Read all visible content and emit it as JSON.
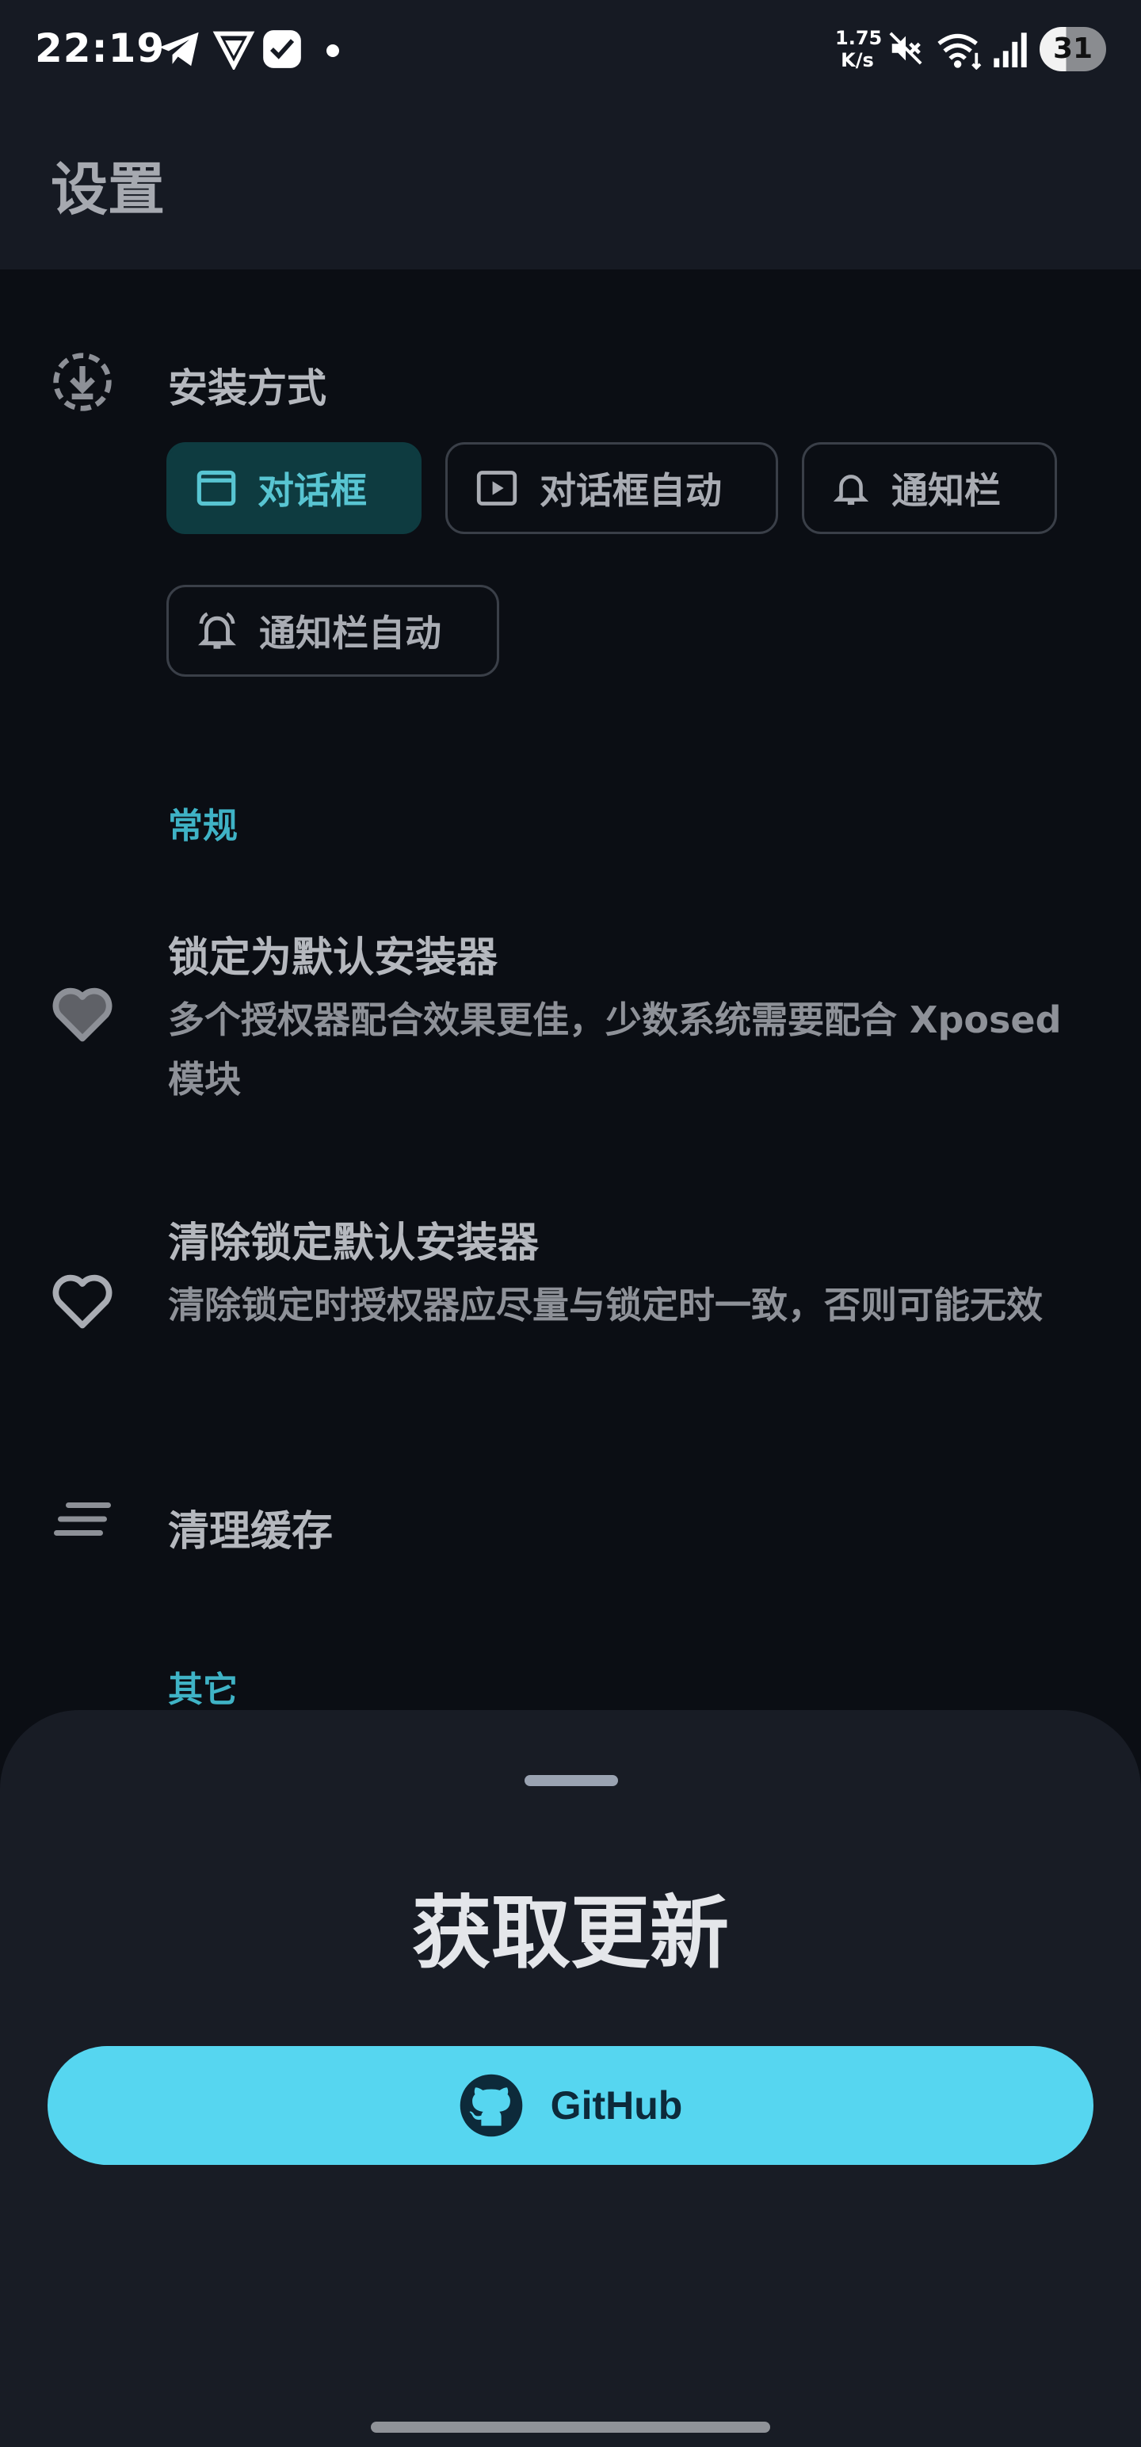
{
  "status_bar": {
    "time": "22:19",
    "net_speed_value": "1.75",
    "net_speed_unit": "K/s",
    "battery": "31",
    "icons": [
      "telegram-icon",
      "vpn-icon",
      "notification-app-icon",
      "dot-icon",
      "mute-icon",
      "wifi-icon",
      "signal-icon",
      "battery-icon"
    ]
  },
  "app_bar": {
    "title": "设置"
  },
  "install_method": {
    "title": "安装方式",
    "icon": "download-icon",
    "options": [
      {
        "label": "对话框",
        "icon": "window-icon",
        "selected": true
      },
      {
        "label": "对话框自动",
        "icon": "play-icon",
        "selected": false
      },
      {
        "label": "通知栏",
        "icon": "bell-icon",
        "selected": false
      },
      {
        "label": "通知栏自动",
        "icon": "bell-ring-icon",
        "selected": false
      }
    ]
  },
  "general": {
    "category": "常规",
    "items": [
      {
        "title": "锁定为默认安装器",
        "desc": "多个授权器配合效果更佳，少数系统需要配合 Xposed模块",
        "icon": "heart-filled-icon"
      },
      {
        "title": "清除锁定默认安装器",
        "desc": "清除锁定时授权器应尽量与锁定时一致，否则可能无效",
        "icon": "heart-outline-icon"
      },
      {
        "title": "清理缓存",
        "icon": "clear-lines-icon"
      }
    ]
  },
  "other": {
    "category": "其它"
  },
  "sheet": {
    "title": "获取更新",
    "button_label": "GitHub",
    "button_icon": "github-icon"
  },
  "colors": {
    "accent": "#3fb3c6",
    "button": "#56d6f0",
    "selected_chip_bg": "#0e3b40",
    "background": "#0b0e14",
    "surface": "#161a23"
  }
}
